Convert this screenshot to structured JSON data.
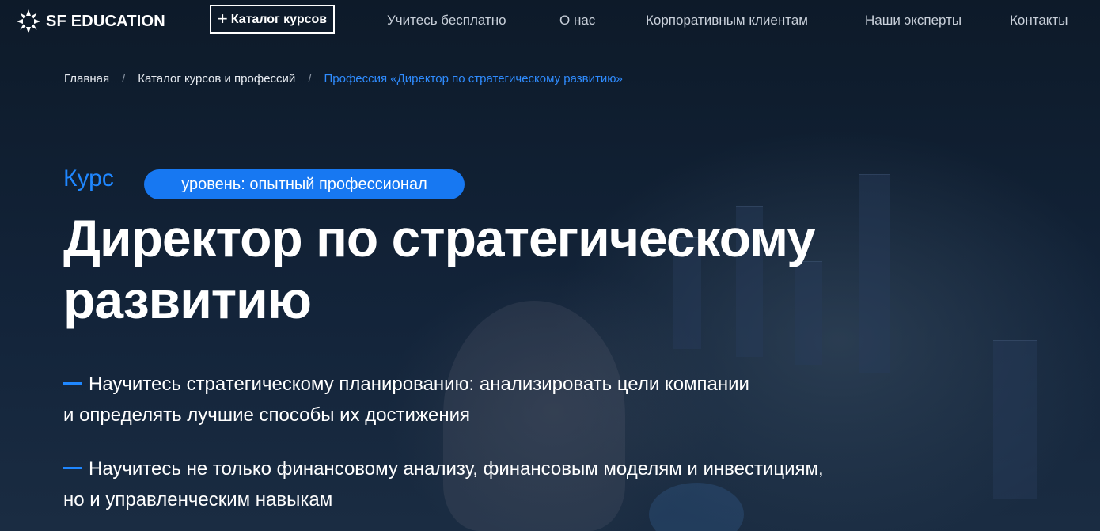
{
  "header": {
    "logo_text": "SF EDUCATION",
    "catalog_button": {
      "icon": "plus-icon",
      "label": "Каталог курсов"
    },
    "nav_items": [
      "Учитесь бесплатно",
      "О нас",
      "Корпоративным клиентам",
      "Наши эксперты",
      "Контакты"
    ]
  },
  "breadcrumb": {
    "items": [
      "Главная",
      "Каталог курсов и профессий",
      "Профессия «Директор по стратегическому развитию»"
    ],
    "separator": "/"
  },
  "hero": {
    "type_label": "Курс",
    "level_badge": "уровень: опытный профессионал",
    "title_line1": "Директор по стратегическому",
    "title_line2": "развитию",
    "benefits": [
      {
        "line1": "Научитесь стратегическому планированию: анализировать цели компании",
        "line2": "и определять лучшие способы их достижения"
      },
      {
        "line1": "Научитесь не только финансовому анализу, финансовым моделям и инвестициям,",
        "line2": "но и управленческим навыкам"
      }
    ]
  },
  "colors": {
    "background": "#0f1c2b",
    "accent": "#1f87ff",
    "badge": "#1778f2",
    "breadcrumb_active": "#2f8cff"
  }
}
